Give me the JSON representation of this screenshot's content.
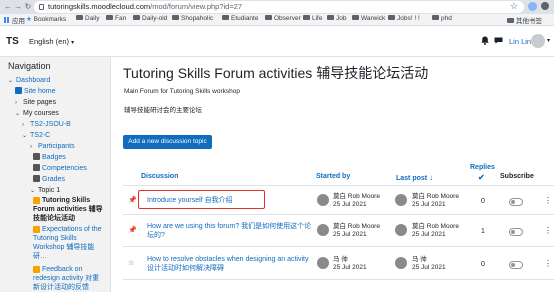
{
  "browser": {
    "url_host": "tutoringskills.moodlecloud.com",
    "url_path": "/mod/forum/view.php?id=27",
    "bookmarks": [
      "应用",
      "Bookmarks",
      "Daily",
      "Fan",
      "Daily-old",
      "Shopaholic",
      "Etudiante",
      "Observer",
      "Life",
      "Job",
      "Warwick",
      "Jobs! ! !",
      "phd",
      "其他书签"
    ]
  },
  "navbar": {
    "brand": "TS",
    "language": "English (en)",
    "user_name": "Lin Lin"
  },
  "drawer": {
    "title": "Navigation",
    "dashboard": "Dashboard",
    "site_home": "Site home",
    "site_pages": "Site pages",
    "my_courses": "My courses",
    "ts2_jsou_b": "TS2-JSOU-B",
    "ts2_c": "TS2-C",
    "participants": "Participants",
    "badges": "Badges",
    "competencies": "Competencies",
    "grades": "Grades",
    "topic1": "Topic 1",
    "forum_active": "Tutoring Skills Forum activities 辅导技能论坛活动",
    "expectations": "Expectations of the Tutoring Skills Workshop 辅导技能研…",
    "feedback": "Feedback on redesign activity 对重新设计活动的反馈"
  },
  "main": {
    "title": "Tutoring Skills Forum activities 辅导技能论坛活动",
    "intro_en": "Main Forum for Tutoring Skills workshop",
    "intro_zh": "辅导技能研讨会的主要论坛",
    "add_button": "Add a new discussion topic",
    "columns": {
      "discussion": "Discussion",
      "started_by": "Started by",
      "last_post": "Last post",
      "replies": "Replies",
      "subscribe": "Subscribe"
    },
    "rows": [
      {
        "title": "Introduce yourself 自我介绍",
        "started_name": "莫白 Rob Moore",
        "started_date": "25 Jul 2021",
        "last_name": "莫白 Rob Moore",
        "last_date": "25 Jul 2021",
        "replies": "0"
      },
      {
        "title": "How are we using this forum? 我们是如何使用这个论坛的?",
        "started_name": "莫白 Rob Moore",
        "started_date": "25 Jul 2021",
        "last_name": "莫白 Rob Moore",
        "last_date": "25 Jul 2021",
        "replies": "1"
      },
      {
        "title": "How to resolve obstacles when designing an activity 设计活动时如何解决障碍",
        "started_name": "马 帅",
        "started_date": "25 Jul 2021",
        "last_name": "马 帅",
        "last_date": "25 Jul 2021",
        "replies": "0"
      }
    ]
  },
  "colors": {
    "accent": "#0f6cbf",
    "highlight": "#e0342c"
  }
}
